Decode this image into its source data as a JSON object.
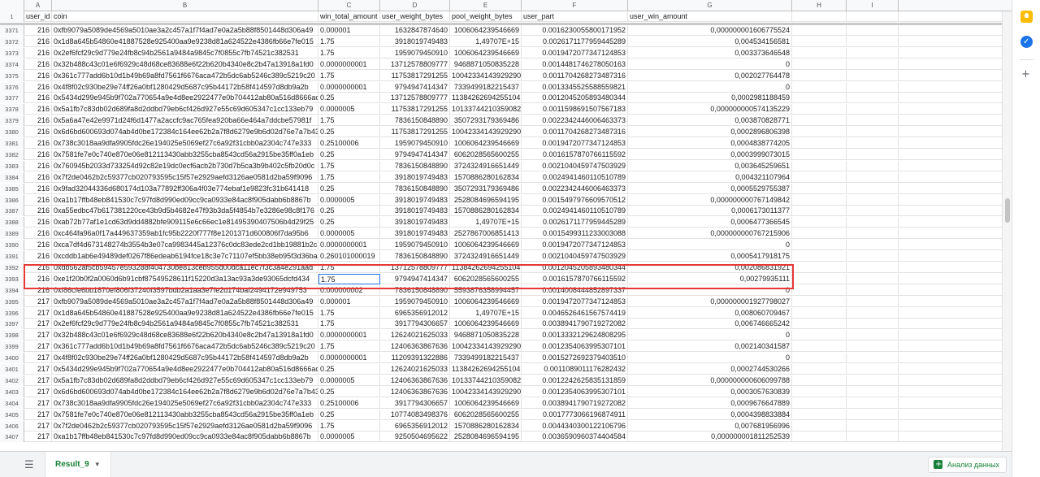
{
  "columns": [
    "A",
    "B",
    "C",
    "D",
    "E",
    "F",
    "G",
    "H",
    "I"
  ],
  "header_row": {
    "number": "1",
    "cells": [
      "user_id",
      "coin",
      "win_total_amount",
      "user_weight_bytes",
      "pool_weight_bytes",
      "user_part",
      "user_win_amount",
      "",
      ""
    ]
  },
  "rows": [
    {
      "n": "3371",
      "a": "216",
      "b": "0xfb9079a5089de4569a5010ae3a2c457a1f7f4ad7e0a2a5b88f8501448d306a49",
      "c": "0.000001",
      "d": "1632847874640",
      "e": "1006064239546669",
      "f": "0.0016230055800171952",
      "g": "0,000000001606775524"
    },
    {
      "n": "3372",
      "a": "216",
      "b": "0x1d8a645b54860e41887528e925400aa9e9238d81a624522e4386fb66e7fe015",
      "c": "1.75",
      "d": "3918019749483",
      "e": "1,49707E+15",
      "f": "0.0026171177959445289",
      "g": "0,004534156581"
    },
    {
      "n": "3373",
      "a": "216",
      "b": "0x2ef6fcf29c9d779e24fb8c94b2561a9484a9845c7f0855c7fb74521c382531",
      "c": "1.75",
      "d": "1959079450910",
      "e": "1006064239546669",
      "f": "0.0019472077347124853",
      "g": "0,003373646548"
    },
    {
      "n": "3374",
      "a": "216",
      "b": "0x32b488c43c01e6f6929c48d68ce83688e6f22b620b4340e8c2b47a13918a1fd0",
      "c": "0.0000000001",
      "d": "13712578809777",
      "e": "9468871050835228",
      "f": "0.0014481746278050163",
      "g": "0"
    },
    {
      "n": "3375",
      "a": "216",
      "b": "0x361c777add6b10d1b49b69a8fd7561f6676aca472b5dc6ab5246c389c5219c20",
      "c": "1.75",
      "d": "11753817291255",
      "e": "10042334143929290",
      "f": "0.0011704268273487316",
      "g": "0,002027764478"
    },
    {
      "n": "3376",
      "a": "216",
      "b": "0x4f8f02c930be29e74ff26a0bf1280429d5687c95b44172b58f414597d8db9a2b",
      "c": "0.0000000001",
      "d": "9794947414347",
      "e": "7339499182215437",
      "f": "0.0013345525588559821",
      "g": "0"
    },
    {
      "n": "3377",
      "a": "216",
      "b": "0x5434d299e945b9f702a770654a9e4d8ee2922477e0b704412ab80a516d8666ac",
      "c": "0.25",
      "d": "13712578809777",
      "e": "11384262694255104",
      "f": "0.0012045205893480344",
      "g": "0,0002981188459"
    },
    {
      "n": "3378",
      "a": "216",
      "b": "0x5a1fb7c83db02d689fa8d2ddbd79eb6cf426d927e55c69d605347c1cc133eb79",
      "c": "0.0000005",
      "d": "11753817291255",
      "e": "10133744210359082",
      "f": "0.0011598691507567183",
      "g": "0,000000000574135229"
    },
    {
      "n": "3379",
      "a": "216",
      "b": "0x5a6a47e42e9971d24f6d1477a2accfc9ac765fea920ba66e464a7ddcbe57981f",
      "c": "1.75",
      "d": "7836150848890",
      "e": "3507293179369486",
      "f": "0.0022342446006463373",
      "g": "0,003870828771"
    },
    {
      "n": "3380",
      "a": "216",
      "b": "0x6d6bd600693d074ab4d0be172384c164ee62b2a7f8d6279e9b6d02d76e7a7b43",
      "c": "0.25",
      "d": "11753817291255",
      "e": "10042334143929290",
      "f": "0.0011704268273487316",
      "g": "0,0002896806398"
    },
    {
      "n": "3381",
      "a": "216",
      "b": "0x738c3018aa9dfa9905fdc26e194025e5069ef27c6a92f31cbb0a2304c747e333",
      "c": "0.25100006",
      "d": "1959079450910",
      "e": "1006064239546669",
      "f": "0.0019472077347124853",
      "g": "0,0004838774205"
    },
    {
      "n": "3382",
      "a": "216",
      "b": "0x7581fe7e0c740e870e06e812113430abb3255cba8543cd56a2915be35ff0a1eb",
      "c": "0.25",
      "d": "9794947414347",
      "e": "6062028565600255",
      "f": "0.0016157870766115592",
      "g": "0,0003999073015"
    },
    {
      "n": "3383",
      "a": "216",
      "b": "0x760945b2033d733254d92c82e19dc0ecf6acb2b730d7b5ca3b9b402c5fb20d0c",
      "c": "1.75",
      "d": "7836150848890",
      "e": "3724324916651449",
      "f": "0.0021040459747503929",
      "g": "0,003645259651"
    },
    {
      "n": "3384",
      "a": "216",
      "b": "0x7f2de0462b2c59377cb020793595c15f57e2929aefd3126ae0581d2ba59f9096",
      "c": "1.75",
      "d": "3918019749483",
      "e": "1570886280162834",
      "f": "0.0024941460110510789",
      "g": "0,004321107964"
    },
    {
      "n": "3385",
      "a": "216",
      "b": "0x9fad32044336d680174d103a77892ff306a4f03e774ebaf1e9823fc31b641418",
      "c": "0.25",
      "d": "7836150848890",
      "e": "3507293179369486",
      "f": "0.0022342446006463373",
      "g": "0,0005529755387"
    },
    {
      "n": "3386",
      "a": "216",
      "b": "0xa1b17ffb48eb841530c7c97fd8d990ed09cc9ca0933e84ac8f905dabb6b8867b",
      "c": "0.0000005",
      "d": "3918019749483",
      "e": "2528084696594195",
      "f": "0.0015497976609570512",
      "g": "0,000000000767149842"
    },
    {
      "n": "3387",
      "a": "216",
      "b": "0xa55edbc47b617381220ce43b9d5b4682e47f93b3da5f4854b7e3286e98c8f176",
      "c": "0.25",
      "d": "3918019749483",
      "e": "1570886280162834",
      "f": "0.0024941460110510789",
      "g": "0,0006173011377"
    },
    {
      "n": "3388",
      "a": "216",
      "b": "0xab72b77af1e1cd63d9dd4882bfe909115e6c66ec1e81495390407506b4d29f25",
      "c": "0.25",
      "d": "3918019749483",
      "e": "1,49707E+15",
      "f": "0.0026171177959445289",
      "g": "0,0006477366545"
    },
    {
      "n": "3389",
      "a": "216",
      "b": "0xc464fa96a0f17a449637359ab1fc95b2220f777f8e1201371d600806f7da95b6",
      "c": "0.0000005",
      "d": "3918019749483",
      "e": "2527867006851413",
      "f": "0.0015499311233003088",
      "g": "0,000000000767215906"
    },
    {
      "n": "3390",
      "a": "216",
      "b": "0xca7df4d673148274b3554b3e07ca9983445a12376c0dc83ede2cd1bb19881b2c",
      "c": "0.0000000001",
      "d": "1959079450910",
      "e": "1006064239546669",
      "f": "0.0019472077347124853",
      "g": "0"
    },
    {
      "n": "3391",
      "a": "216",
      "b": "0xcddb1ab6e49489def0267f86edeab6194fce18c3e7c71107ef5bb38eb95f3d36ba",
      "c": "0.260101000019",
      "d": "7836150848890",
      "e": "3724324916651449",
      "f": "0.0021040459747503929",
      "g": "0,0005417918175"
    },
    {
      "n": "3392",
      "a": "216",
      "b": "0xdb562af5cb59457e593288f404730be813ceb955d00dca11ec7f3c3a4e291aad",
      "c": "1.75",
      "d": "13712578809777",
      "e": "11384262694255104",
      "f": "0.0012045205893480344",
      "g": "0,002086831921"
    },
    {
      "n": "3393",
      "a": "216",
      "b": "0xe1f20b0f2a0060d6b91cbf87549528611f15220d3a13ac93a3de93065dcfd434",
      "c": "1.75",
      "d": "9794947414347",
      "e": "6062028565600255",
      "f": "0.0016157870766115592",
      "g": "0,00279935111",
      "active": true
    },
    {
      "n": "3394",
      "a": "216",
      "b": "0xf86cfe6bb1870ef806f37240f3597bdb2a1aa3e7fe2d174baf2494172e949753",
      "c": "0.000000002",
      "d": "7836150848890",
      "e": "5593876358994457",
      "f": "0.0014008444852897337",
      "g": "0"
    },
    {
      "n": "3395",
      "a": "217",
      "b": "0xfb9079a5089de4569a5010ae3a2c457a1f7f4ad7e0a2a5b88f8501448d306a49",
      "c": "0.000001",
      "d": "1959079450910",
      "e": "1006064239546669",
      "f": "0.0019472077347124853",
      "g": "0,000000001927798027"
    },
    {
      "n": "3396",
      "a": "217",
      "b": "0x1d8a645b54860e41887528e925400aa9e9238d81a624522e4386fb66e7fe015",
      "c": "1.75",
      "d": "6965356912012",
      "e": "1,49707E+15",
      "f": "0.0046526461567574419",
      "g": "0,008060709467"
    },
    {
      "n": "3397",
      "a": "217",
      "b": "0x2ef6fcf29c9d779e24fb8c94b2561a9484a9845c7f0855c7fb74521c382531",
      "c": "1.75",
      "d": "3917794306657",
      "e": "1006064239546669",
      "f": "0.0038941790719272082",
      "g": "0,006746665242"
    },
    {
      "n": "3398",
      "a": "217",
      "b": "0x32b488c43c01e6f6929c48d68ce83688e6f22b620b4340e8c2b47a13918a1fd0",
      "c": "0.0000000001",
      "d": "12624021625033",
      "e": "9468871050835228",
      "f": "0.0013332129624808295",
      "g": "0"
    },
    {
      "n": "3399",
      "a": "217",
      "b": "0x361c777add6b10d1b49b69a8fd7561f6676aca472b5dc6ab5246c389c5219c20",
      "c": "1.75",
      "d": "12406363867636",
      "e": "10042334143929290",
      "f": "0.0012354063995307101",
      "g": "0,002140341587"
    },
    {
      "n": "3400",
      "a": "217",
      "b": "0x4f8f02c930be29e74ff26a0bf1280429d5687c95b44172b58f414597d8db9a2b",
      "c": "0.0000000001",
      "d": "11209391322886",
      "e": "7339499182215437",
      "f": "0.0015272692379403510",
      "g": "0"
    },
    {
      "n": "3401",
      "a": "217",
      "b": "0x5434d299e945b9f702a770654a9e4d8ee2922477e0b704412ab80a516d8666ac",
      "c": "0.25",
      "d": "12624021625033",
      "e": "11384262694255104",
      "f": "0.0011089011176282432",
      "g": "0,0002744530266"
    },
    {
      "n": "3402",
      "a": "217",
      "b": "0x5a1fb7c83db02d689fa8d2ddbd79eb6cf426d927e55c69d605347c1cc133eb79",
      "c": "0.0000005",
      "d": "12406363867636",
      "e": "10133744210359082",
      "f": "0.0012242625835131859",
      "g": "0,000000000606099788"
    },
    {
      "n": "3403",
      "a": "217",
      "b": "0x6d6bd600693d074ab4d0be172384c164ee62b2a7f8d6279e9b6d02d76e7a7b43",
      "c": "0.25",
      "d": "12406363867636",
      "e": "10042334143929290",
      "f": "0.0012354063995307101",
      "g": "0,0003057630839"
    },
    {
      "n": "3404",
      "a": "217",
      "b": "0x738c3018aa9dfa9905fdc26e194025e5069ef27c6a92f31cbb0a2304c747e333",
      "c": "0.25100006",
      "d": "3917794306657",
      "e": "1006064239546669",
      "f": "0.0038941790719272082",
      "g": "0,0009676647889"
    },
    {
      "n": "3405",
      "a": "217",
      "b": "0x7581fe7e0c740e870e06e812113430abb3255cba8543cd56a2915be35ff0a1eb",
      "c": "0.25",
      "d": "10774083498376",
      "e": "6062028565600255",
      "f": "0.0017773066196874911",
      "g": "0,0004398833884"
    },
    {
      "n": "3406",
      "a": "217",
      "b": "0x7f2de0462b2c59377cb020793595c15f57e2929aefd3126ae0581d2ba59f9096",
      "c": "1.75",
      "d": "6965356912012",
      "e": "1570886280162834",
      "f": "0.0044340300122106796",
      "g": "0,007681956996"
    },
    {
      "n": "3407",
      "a": "217",
      "b": "0xa1b17ffb48eb841530c7c97fd8d990ed09cc9ca0933e84ac8f905dabb6b8867b",
      "c": "0.0000005",
      "d": "9250504695622",
      "e": "2528084696594195",
      "f": "0.0036590960374404584",
      "g": "0,000000001811252539"
    }
  ],
  "bottom": {
    "sheet_tab": "Result_9",
    "explore_label": "Анализ данных"
  },
  "colors": {
    "highlight": "#e53935",
    "active_cell": "#1a73e8",
    "sheet_tab_text": "#188038"
  }
}
